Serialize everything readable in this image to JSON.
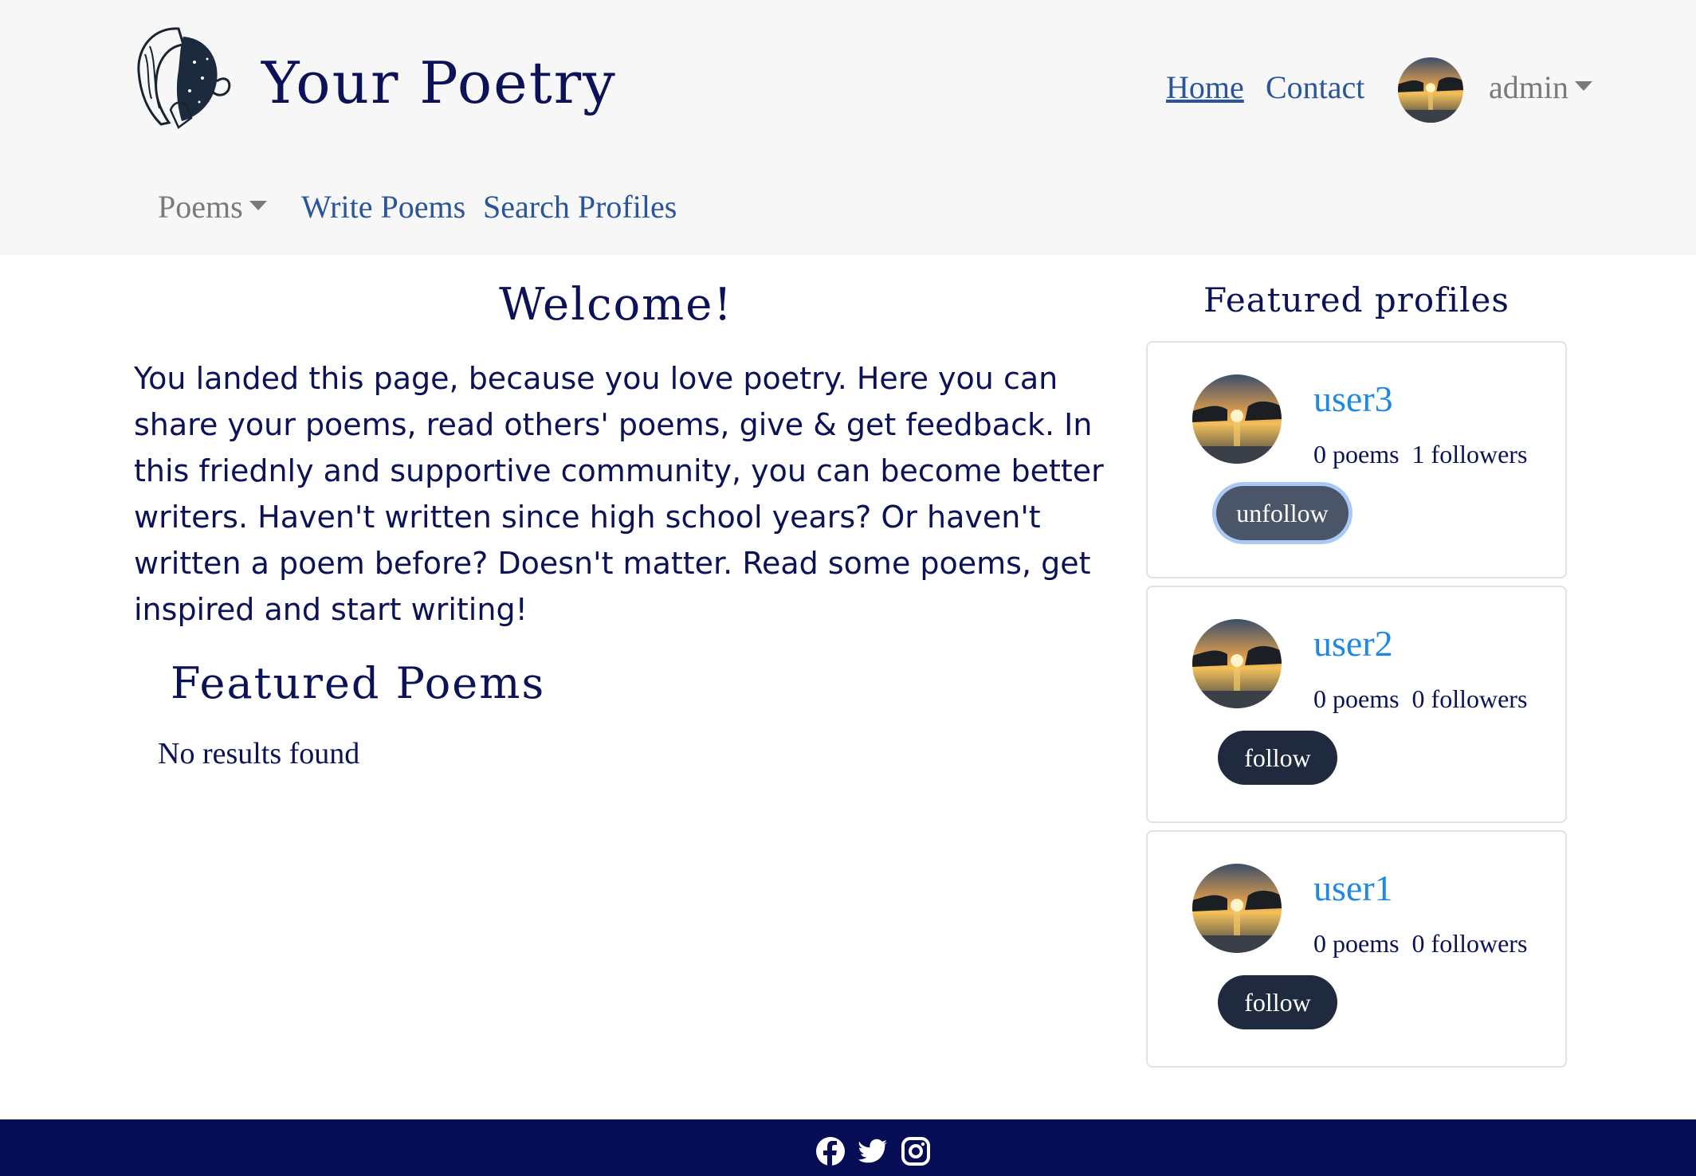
{
  "brand": {
    "name": "Your Poetry",
    "logo_icon": "poet-portrait-logo"
  },
  "top_nav": {
    "home": "Home",
    "contact": "Contact",
    "user": "admin"
  },
  "sub_nav": {
    "poems": "Poems",
    "write": "Write Poems",
    "search": "Search Profiles"
  },
  "main": {
    "welcome_title": "Welcome!",
    "intro": "You landed this page, because you love poetry. Here you can share your poems, read others' poems, give & get feedback. In this friednly and supportive community, you can become better writers. Haven't written since high school years? Or haven't written a poem before? Doesn't matter. Read some poems, get inspired and start writing!",
    "featured_poems_title": "Featured Poems",
    "no_results": "No results found"
  },
  "featured_profiles": {
    "title": "Featured profiles",
    "profiles": [
      {
        "name": "user3",
        "stats": "0 poems  1 followers",
        "button": "unfollow"
      },
      {
        "name": "user2",
        "stats": "0 poems  0 followers",
        "button": "follow"
      },
      {
        "name": "user1",
        "stats": "0 poems  0 followers",
        "button": "follow"
      }
    ]
  },
  "footer": {
    "icons": [
      "facebook-icon",
      "twitter-icon",
      "instagram-icon"
    ]
  },
  "colors": {
    "navy": "#0b1257",
    "link": "#2a5599",
    "profile_link": "#1e88e5",
    "footer": "#070d55",
    "button": "#1f2a3f"
  }
}
